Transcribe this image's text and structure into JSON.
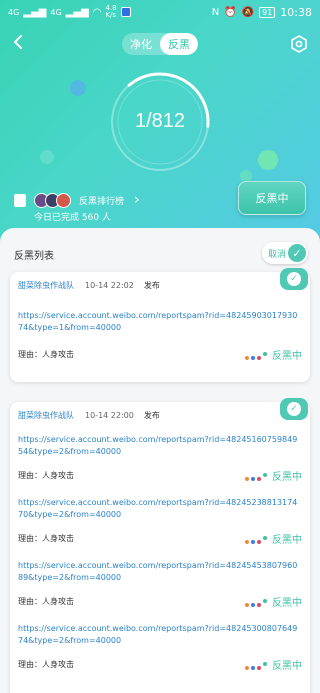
{
  "status_bar": {
    "network_left": "4G",
    "network_right": "4G",
    "speed": "4.8",
    "speed_unit": "K/s",
    "battery": "91",
    "time": "10:38"
  },
  "tabs": [
    {
      "label": "净化",
      "active": false
    },
    {
      "label": "反黑",
      "active": true
    }
  ],
  "progress": {
    "text": "1/812",
    "done": 1,
    "total": 812
  },
  "rank": {
    "label": "反黑排行榜"
  },
  "today_done": "今日已完成 560 人",
  "status_button": "反黑中",
  "list": {
    "title": "反黑列表",
    "cancel_label": "取消",
    "cards": [
      {
        "team": "甜菜除虫作战队",
        "time": "10-14 22:02",
        "action": "发布",
        "entries": [
          {
            "url": "https://service.account.weibo.com/reportspam?rid=4824590301793074&type=1&from=40000",
            "reason": "理由：人身攻击",
            "status": "反黑中"
          }
        ]
      },
      {
        "team": "甜菜除虫作战队",
        "time": "10-14 22:00",
        "action": "发布",
        "entries": [
          {
            "url": "https://service.account.weibo.com/reportspam?rid=4824516075984954&type=2&from=40000",
            "reason": "理由：人身攻击",
            "status": "反黑中"
          },
          {
            "url": "https://service.account.weibo.com/reportspam?rid=4824523881317470&type=2&from=40000",
            "reason": "理由：人身攻击",
            "status": "反黑中"
          },
          {
            "url": "https://service.account.weibo.com/reportspam?rid=4824545380796089&type=2&from=40000",
            "reason": "理由：人身攻击",
            "status": "反黑中"
          },
          {
            "url": "https://service.account.weibo.com/reportspam?rid=4824530080764974&type=2&from=40000",
            "reason": "理由：人身攻击",
            "status": "反黑中"
          }
        ]
      }
    ]
  },
  "colors": {
    "accent": "#3fc1a8",
    "link": "#2b82c9"
  }
}
